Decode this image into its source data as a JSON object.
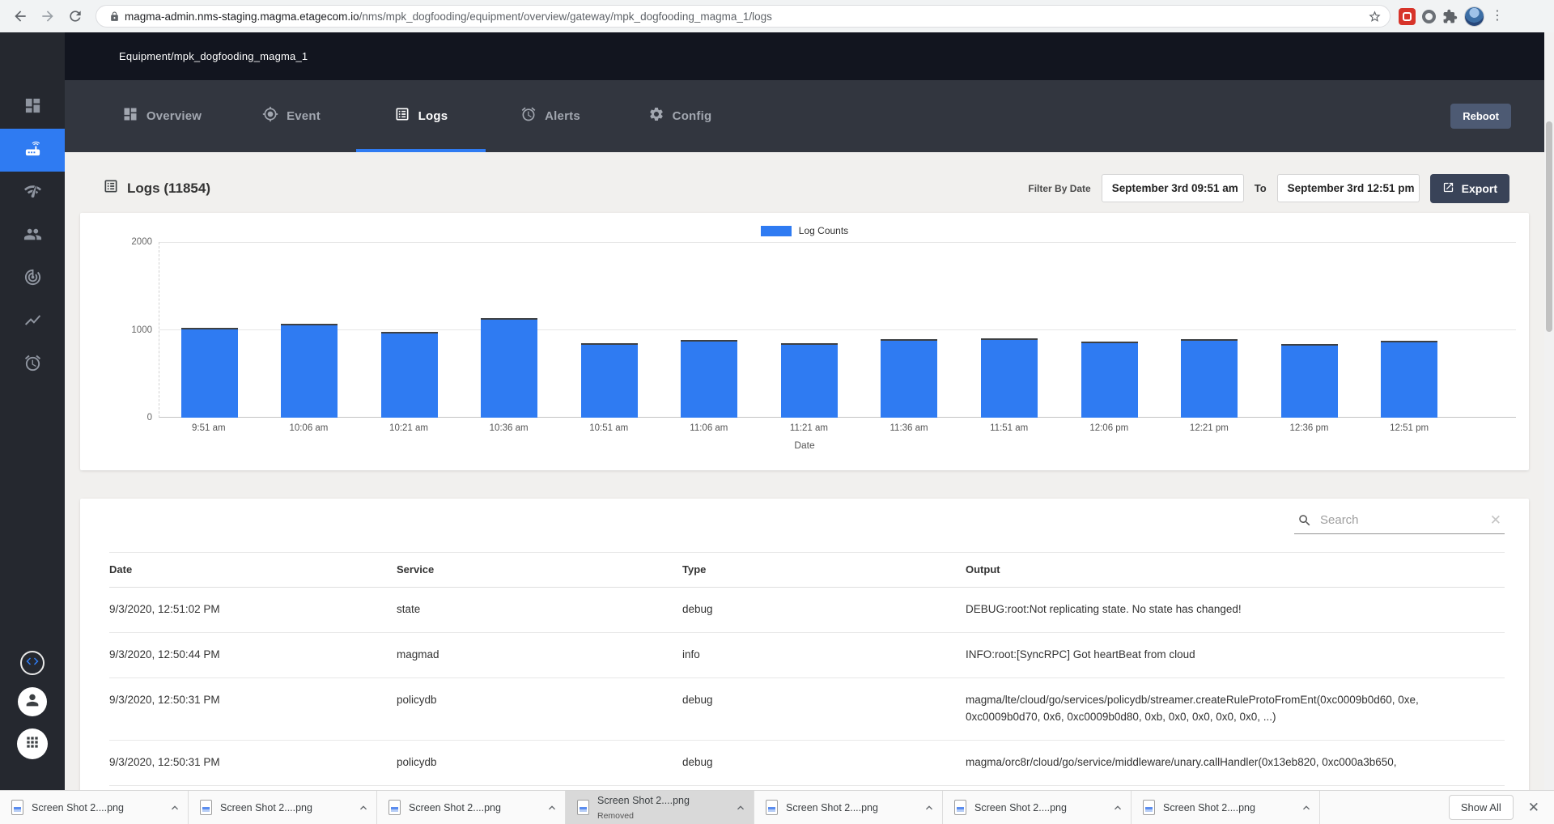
{
  "browser": {
    "url_domain": "magma-admin.nms-staging.magma.etagecom.io",
    "url_path": "/nms/mpk_dogfooding/equipment/overview/gateway/mpk_dogfooding_magma_1/logs"
  },
  "header": {
    "breadcrumb": "Equipment/mpk_dogfooding_magma_1",
    "reboot_label": "Reboot"
  },
  "tabs": [
    {
      "label": "Overview",
      "active": false
    },
    {
      "label": "Event",
      "active": false
    },
    {
      "label": "Logs",
      "active": true
    },
    {
      "label": "Alerts",
      "active": false
    },
    {
      "label": "Config",
      "active": false
    }
  ],
  "logs_panel": {
    "title": "Logs (11854)",
    "filter_label": "Filter By Date",
    "from_value": "September 3rd 09:51 am",
    "to_label": "To",
    "to_value": "September 3rd 12:51 pm",
    "export_label": "Export"
  },
  "chart_data": {
    "type": "bar",
    "series_label": "Log Counts",
    "bar_color": "#2f7bf2",
    "categories": [
      "9:51 am",
      "10:06 am",
      "10:21 am",
      "10:36 am",
      "10:51 am",
      "11:06 am",
      "11:21 am",
      "11:36 am",
      "11:51 am",
      "12:06 pm",
      "12:21 pm",
      "12:36 pm",
      "12:51 pm"
    ],
    "values": [
      1020,
      1065,
      980,
      1130,
      845,
      885,
      850,
      895,
      900,
      870,
      890,
      835,
      875
    ],
    "xlabel": "Date",
    "ylabel": "",
    "ylim": [
      0,
      2000
    ],
    "yticks": [
      0,
      1000,
      2000
    ],
    "legend_position": "top-center",
    "grid": true
  },
  "search": {
    "placeholder": "Search"
  },
  "table": {
    "columns": [
      "Date",
      "Service",
      "Type",
      "Output"
    ],
    "rows": [
      {
        "date": "9/3/2020, 12:51:02 PM",
        "service": "state",
        "type": "debug",
        "output": "DEBUG:root:Not replicating state. No state has changed!"
      },
      {
        "date": "9/3/2020, 12:50:44 PM",
        "service": "magmad",
        "type": "info",
        "output": "INFO:root:[SyncRPC] Got heartBeat from cloud"
      },
      {
        "date": "9/3/2020, 12:50:31 PM",
        "service": "policydb",
        "type": "debug",
        "output": "magma/lte/cloud/go/services/policydb/streamer.createRuleProtoFromEnt(0xc0009b0d60, 0xe, 0xc0009b0d70, 0x6, 0xc0009b0d80, 0xb, 0x0, 0x0, 0x0, 0x0, ...)"
      },
      {
        "date": "9/3/2020, 12:50:31 PM",
        "service": "policydb",
        "type": "debug",
        "output": "magma/orc8r/cloud/go/service/middleware/unary.callHandler(0x13eb820, 0xc000a3b650,"
      }
    ]
  },
  "downloads": {
    "items": [
      {
        "name": "Screen Shot 2....png",
        "status": ""
      },
      {
        "name": "Screen Shot 2....png",
        "status": ""
      },
      {
        "name": "Screen Shot 2....png",
        "status": ""
      },
      {
        "name": "Screen Shot 2....png",
        "status": "Removed"
      },
      {
        "name": "Screen Shot 2....png",
        "status": ""
      },
      {
        "name": "Screen Shot 2....png",
        "status": ""
      },
      {
        "name": "Screen Shot 2....png",
        "status": ""
      }
    ],
    "show_all_label": "Show All"
  },
  "icons": {
    "lock": "padlock",
    "star": "bookmark-star",
    "export": "open-in-new",
    "search": "magnifier",
    "clear": "x",
    "downloads_expand": "chevron-up",
    "sidebar": [
      "dashboard",
      "gateway-router",
      "network-check",
      "people",
      "radar",
      "line-chart",
      "alarm-clock",
      "code",
      "account",
      "apps-grid"
    ]
  }
}
